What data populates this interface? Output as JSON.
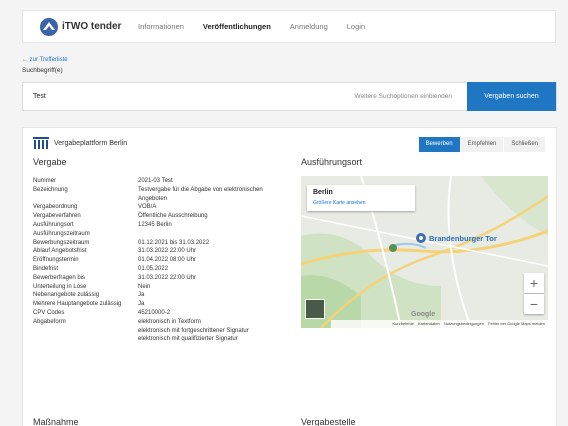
{
  "nav": {
    "brand": "iTWO tender",
    "items": [
      {
        "label": "Informationen",
        "active": false
      },
      {
        "label": "Veröffentlichungen",
        "active": true
      },
      {
        "label": "Anmeldung",
        "active": false
      },
      {
        "label": "Login",
        "active": false
      }
    ]
  },
  "back_link": "← zur Trefferliste",
  "search": {
    "label": "Suchbegriff(e)",
    "value": "Test",
    "more_options": "Weitere Suchoptionen einblenden",
    "button": "Vergaben suchen"
  },
  "card": {
    "platform": "Vergabeplattform Berlin",
    "actions": [
      "Bewerben",
      "Empfehlen",
      "Schließen"
    ],
    "section_vergabe": "Vergabe",
    "section_ort": "Ausführungsort",
    "section_massnahme": "Maßnahme",
    "section_stelle": "Vergabestelle",
    "details": [
      {
        "key": "Nummer",
        "value": [
          "2021-03 Test"
        ]
      },
      {
        "key": "Bezeichnung",
        "value": [
          "Testvergabe für die Abgabe von elektronischen",
          "Angeboten"
        ]
      },
      {
        "key": "Vergabeordnung",
        "value": [
          "VOB/A"
        ]
      },
      {
        "key": "Vergabeverfahren",
        "value": [
          "Öffentliche Ausschreibung"
        ]
      },
      {
        "key": "Ausführungsort",
        "value": [
          "12345 Berlin"
        ]
      },
      {
        "key": "Ausführungszeitraum",
        "value": [
          ""
        ]
      },
      {
        "key": "Bewerbungszeitraum",
        "value": [
          "01.12.2021 bis 31.03.2022"
        ]
      },
      {
        "key": "Ablauf Angebotsfrist",
        "value": [
          "31.03.2022 22:00 Uhr"
        ]
      },
      {
        "key": "Eröffnungstermin",
        "value": [
          "01.04.2022 08:00 Uhr"
        ]
      },
      {
        "key": "Bindefrist",
        "value": [
          "01.05.2022"
        ]
      },
      {
        "key": "Bewerberfragen bis",
        "value": [
          "31.03.2022 22:00 Uhr"
        ]
      },
      {
        "key": "Unterteilung in Lose",
        "value": [
          "Nein"
        ]
      },
      {
        "key": "Nebenangebote zulässig",
        "value": [
          "Ja"
        ]
      },
      {
        "key": "Mehrere Hauptangebote zulässig",
        "value": [
          "Ja"
        ]
      },
      {
        "key": "CPV Codes",
        "value": [
          "45210000-2"
        ]
      },
      {
        "key": "Abgabeform",
        "value": [
          "elektronisch in Textform",
          "elektronisch mit fortgeschrittener Signatur",
          "elektronisch mit qualifizierter Signatur"
        ]
      }
    ]
  },
  "map": {
    "popup_title": "Berlin",
    "popup_link": "Größere Karte ansehen",
    "marker_label": "Brandenburger Tor",
    "footer": [
      "Kurzbefehle",
      "Kartendaten",
      "Nutzungsbedingungen",
      "Fehler bei Google Maps melden"
    ]
  }
}
